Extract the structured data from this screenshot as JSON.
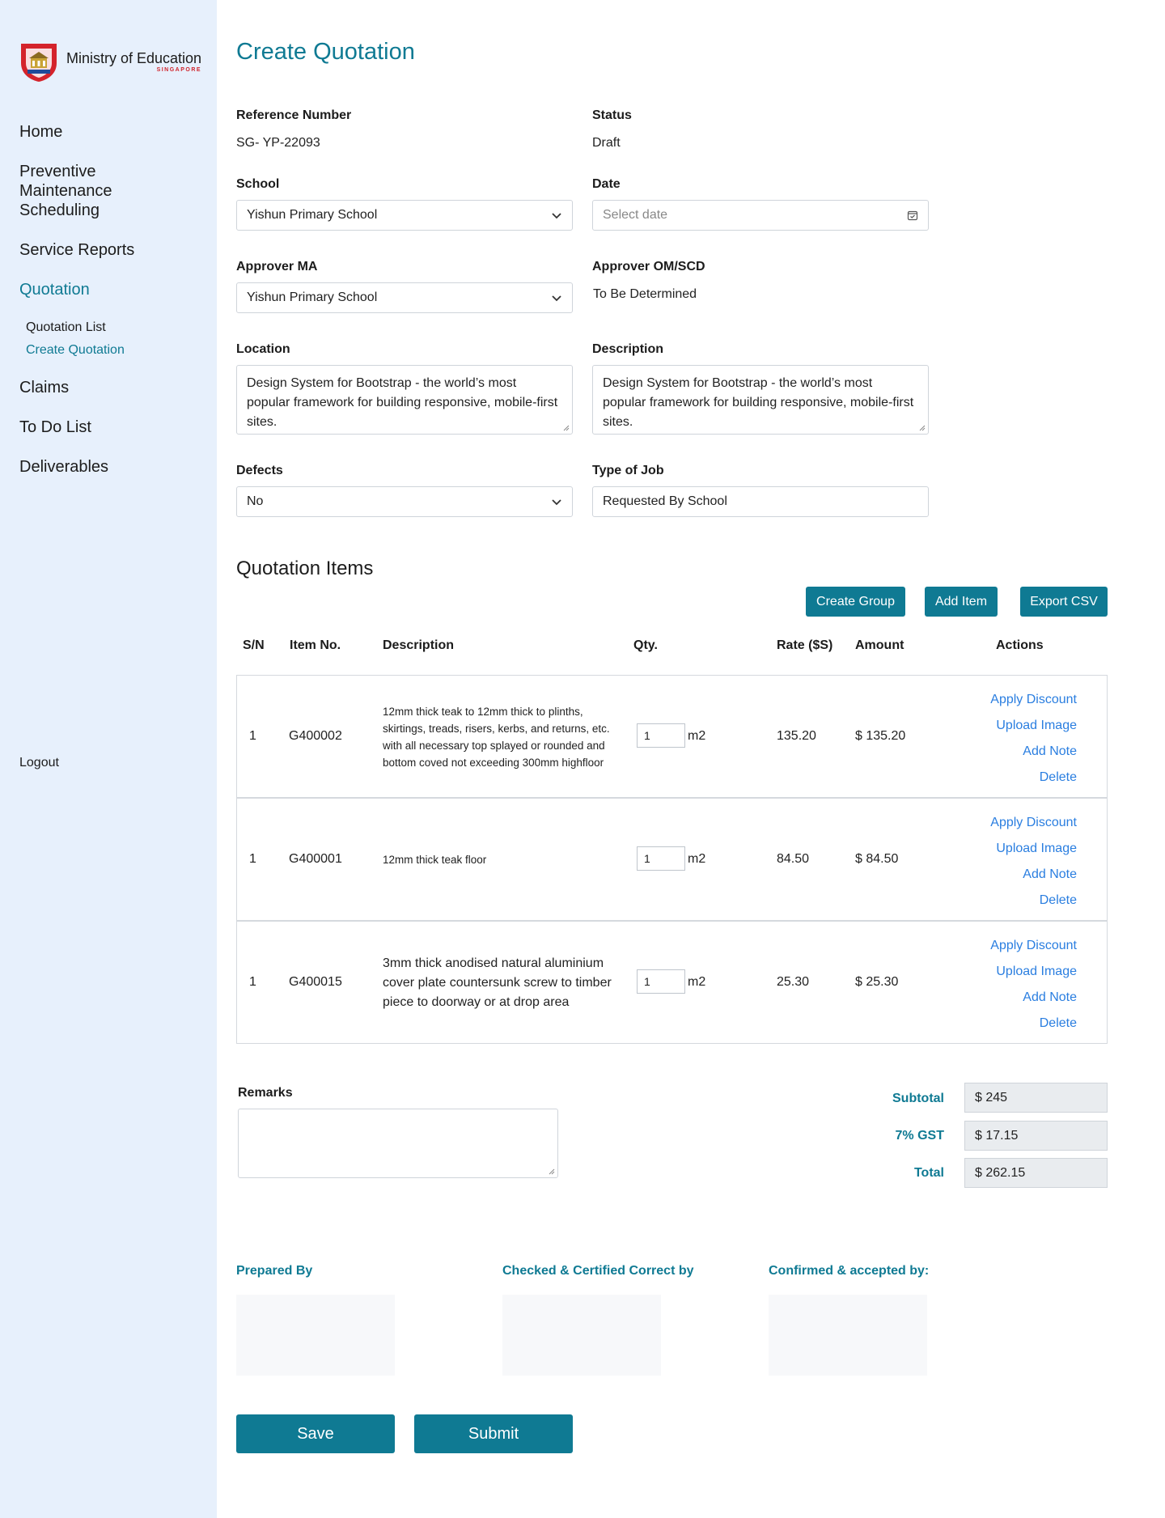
{
  "sidebar": {
    "logo_title": "Ministry of Education",
    "logo_sub": "SINGAPORE",
    "nav": [
      {
        "label": "Home"
      },
      {
        "label": "Preventive\nMaintenance\nScheduling"
      },
      {
        "label": "Service Reports"
      },
      {
        "label": "Quotation"
      },
      {
        "label": "Claims"
      },
      {
        "label": "To Do List"
      },
      {
        "label": "Deliverables"
      }
    ],
    "sub": [
      {
        "label": "Quotation List"
      },
      {
        "label": "Create Quotation"
      }
    ],
    "logout": "Logout",
    "colors": {
      "active": "#0f7a93",
      "background": "#e7f0fc"
    }
  },
  "page": {
    "title": "Create Quotation"
  },
  "form": {
    "reference": {
      "label": "Reference Number",
      "value": "SG- YP-22093"
    },
    "status": {
      "label": "Status",
      "value": "Draft"
    },
    "school": {
      "label": "School",
      "value": "Yishun Primary School"
    },
    "date": {
      "label": "Date",
      "placeholder": "Select date"
    },
    "approver_ma": {
      "label": "Approver MA",
      "value": "Yishun Primary School"
    },
    "approver_om": {
      "label": "Approver OM/SCD",
      "value": "To Be Determined"
    },
    "location": {
      "label": "Location",
      "value": "Design System for Bootstrap - the world’s most popular framework for building responsive, mobile-first sites."
    },
    "description": {
      "label": "Description",
      "value": "Design System for Bootstrap - the world’s most popular framework for building responsive, mobile-first sites."
    },
    "defects": {
      "label": "Defects",
      "value": "No"
    },
    "job_type": {
      "label": "Type of Job",
      "value": "Requested By School"
    }
  },
  "items": {
    "title": "Quotation Items",
    "buttons": {
      "create_group": "Create Group",
      "add_item": "Add Item",
      "export_csv": "Export CSV"
    },
    "headers": {
      "sn": "S/N",
      "item_no": "Item No.",
      "description": "Description",
      "qty": "Qty.",
      "rate": "Rate ($S)",
      "amount": "Amount",
      "actions": "Actions"
    },
    "rows": [
      {
        "sn": "1",
        "item_no": "G400002",
        "description": "12mm thick teak to 12mm thick to plinths, skirtings, treads, risers, kerbs, and returns, etc. with all necessary top splayed or rounded and bottom coved not exceeding 300mm highfloor",
        "qty": "1",
        "unit": "m2",
        "rate": "135.20",
        "amount": "$ 135.20"
      },
      {
        "sn": "1",
        "item_no": "G400001",
        "description": "12mm thick teak floor",
        "qty": "1",
        "unit": "m2",
        "rate": "84.50",
        "amount": "$ 84.50"
      },
      {
        "sn": "1",
        "item_no": "G400015",
        "description": "3mm thick anodised natural aluminium cover plate countersunk screw to timber piece to doorway or at drop area",
        "qty": "1",
        "unit": "m2",
        "rate": "25.30",
        "amount": "$ 25.30"
      }
    ],
    "actions": {
      "apply_discount": "Apply Discount",
      "upload_image": "Upload Image",
      "add_note": "Add Note",
      "delete": "Delete"
    }
  },
  "summary": {
    "remarks_label": "Remarks",
    "subtotal_label": "Subtotal",
    "subtotal": "$ 245",
    "gst_label": "7% GST",
    "gst": "$ 17.15",
    "total_label": "Total",
    "total": "$ 262.15"
  },
  "signoff": {
    "prepared": "Prepared By",
    "checked": "Checked & Certified Correct by",
    "confirmed": "Confirmed & accepted by:"
  },
  "footer": {
    "save": "Save",
    "submit": "Submit"
  }
}
